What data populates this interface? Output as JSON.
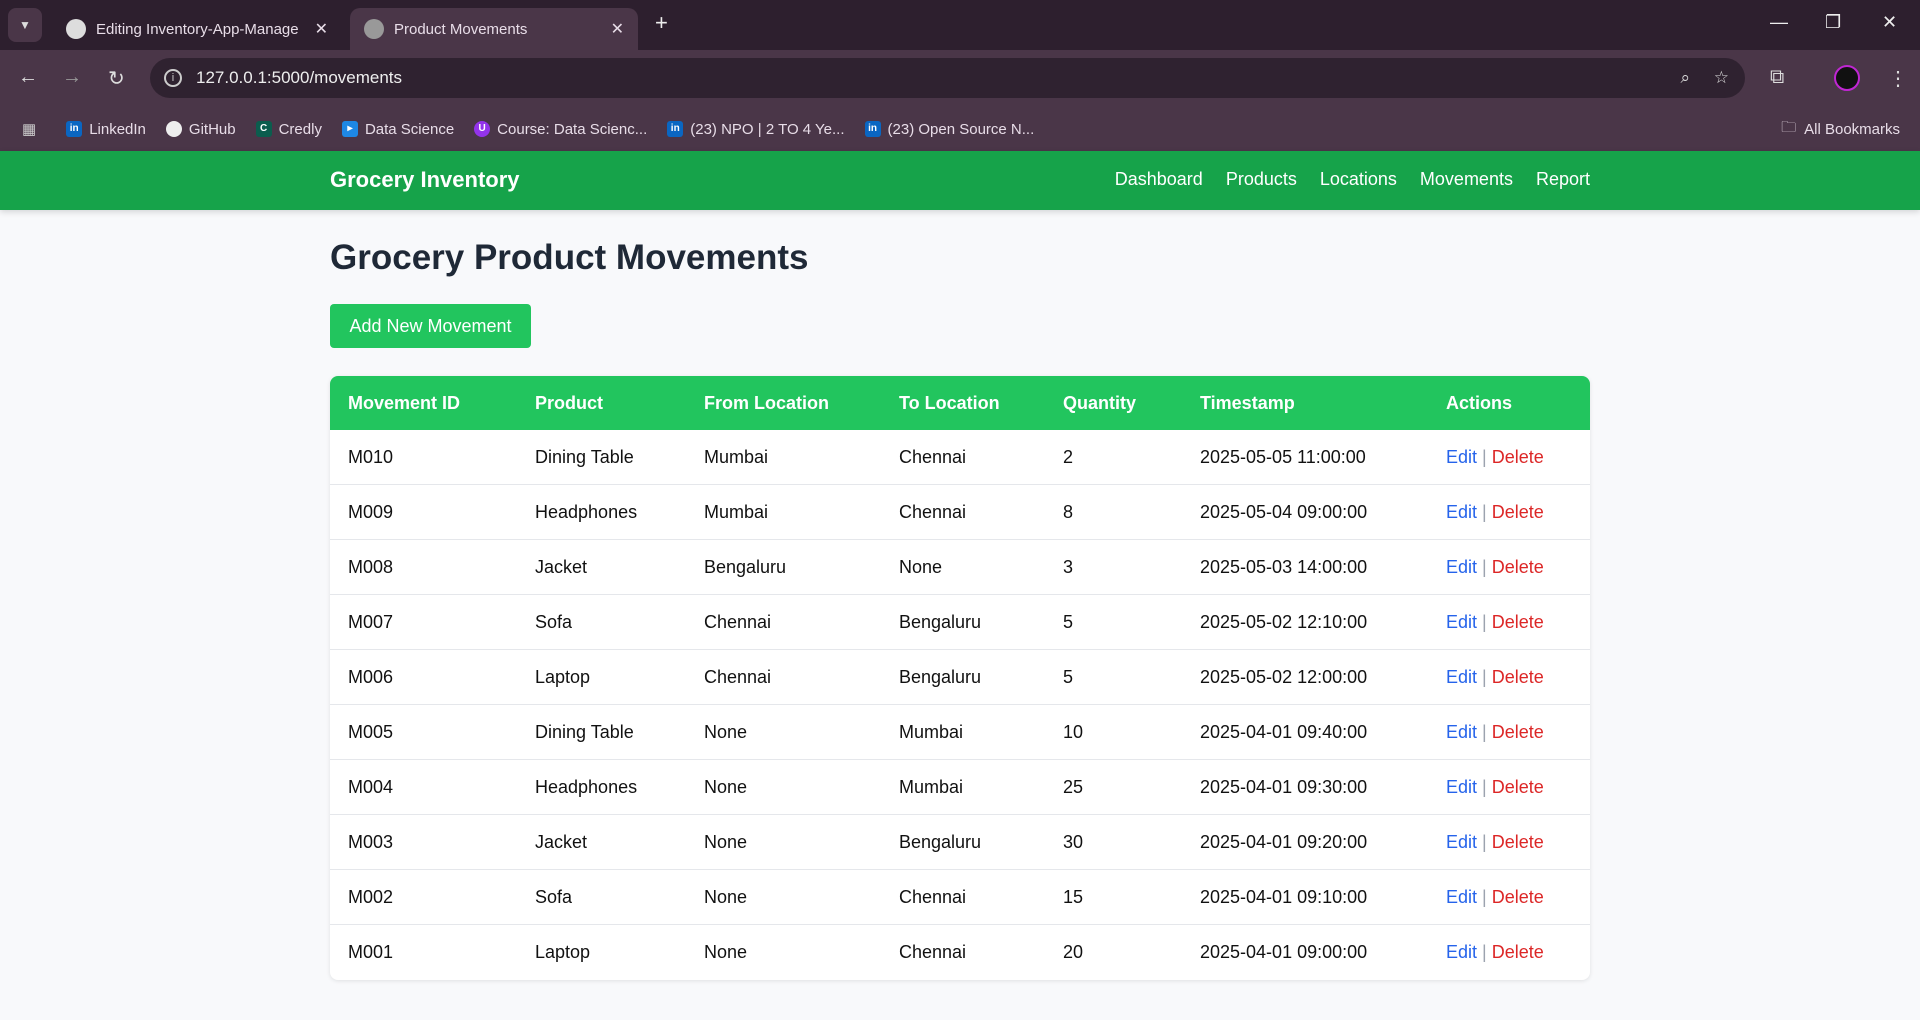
{
  "browser": {
    "tabs": [
      {
        "title": "Editing Inventory-App-Manage"
      },
      {
        "title": "Product Movements"
      }
    ],
    "url": "127.0.0.1:5000/movements",
    "bookmarks": [
      "LinkedIn",
      "GitHub",
      "Credly",
      "Data Science",
      "Course: Data Scienc...",
      "(23) NPO | 2 TO 4 Ye...",
      "(23) Open Source N..."
    ],
    "all_bookmarks": "All Bookmarks"
  },
  "header": {
    "brand": "Grocery Inventory",
    "nav": [
      "Dashboard",
      "Products",
      "Locations",
      "Movements",
      "Report"
    ]
  },
  "page": {
    "title": "Grocery Product Movements",
    "add_button": "Add New Movement"
  },
  "table": {
    "columns": [
      "Movement ID",
      "Product",
      "From Location",
      "To Location",
      "Quantity",
      "Timestamp",
      "Actions"
    ],
    "edit": "Edit",
    "sep": "|",
    "delete": "Delete",
    "rows": [
      [
        "M010",
        "Dining Table",
        "Mumbai",
        "Chennai",
        "2",
        "2025-05-05 11:00:00"
      ],
      [
        "M009",
        "Headphones",
        "Mumbai",
        "Chennai",
        "8",
        "2025-05-04 09:00:00"
      ],
      [
        "M008",
        "Jacket",
        "Bengaluru",
        "None",
        "3",
        "2025-05-03 14:00:00"
      ],
      [
        "M007",
        "Sofa",
        "Chennai",
        "Bengaluru",
        "5",
        "2025-05-02 12:10:00"
      ],
      [
        "M006",
        "Laptop",
        "Chennai",
        "Bengaluru",
        "5",
        "2025-05-02 12:00:00"
      ],
      [
        "M005",
        "Dining Table",
        "None",
        "Mumbai",
        "10",
        "2025-04-01 09:40:00"
      ],
      [
        "M004",
        "Headphones",
        "None",
        "Mumbai",
        "25",
        "2025-04-01 09:30:00"
      ],
      [
        "M003",
        "Jacket",
        "None",
        "Bengaluru",
        "30",
        "2025-04-01 09:20:00"
      ],
      [
        "M002",
        "Sofa",
        "None",
        "Chennai",
        "15",
        "2025-04-01 09:10:00"
      ],
      [
        "M001",
        "Laptop",
        "None",
        "Chennai",
        "20",
        "2025-04-01 09:00:00"
      ]
    ]
  }
}
